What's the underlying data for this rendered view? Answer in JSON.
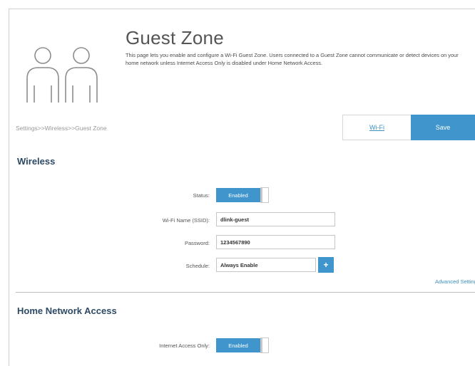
{
  "header": {
    "title": "Guest Zone",
    "description": "This page lets you enable and configure a Wi-Fi Guest Zone. Users connected to a Guest Zone cannot communicate or detect devices on your home network unless Internet Access Only is disabled under Home Network Access."
  },
  "breadcrumb": "Settings>>Wireless>>Guest Zone",
  "tabs": {
    "wifi_label": "Wi-Fi",
    "save_label": "Save"
  },
  "wireless": {
    "title": "Wireless",
    "status_label": "Status:",
    "status_value": "Enabled",
    "ssid_label": "Wi-Fi Name (SSID):",
    "ssid_value": "dlink-guest",
    "password_label": "Password:",
    "password_value": "1234567890",
    "schedule_label": "Schedule:",
    "schedule_value": "Always Enable",
    "add_symbol": "+",
    "advanced_link": "Advanced Settings"
  },
  "home_network": {
    "title": "Home Network Access",
    "internet_only_label": "Internet Access Only:",
    "internet_only_value": "Enabled"
  },
  "colors": {
    "accent": "#3f95cc",
    "section_title": "#2c4a64"
  },
  "icons": {
    "hero": "guest-users-icon"
  }
}
